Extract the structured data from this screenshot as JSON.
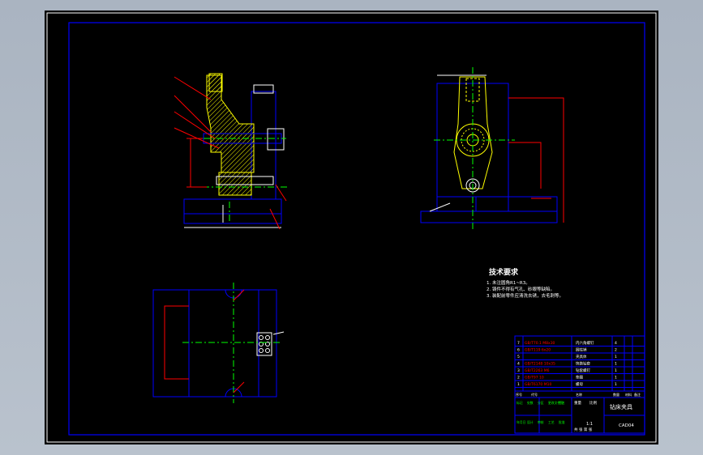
{
  "drawing": {
    "tech_requirements": {
      "heading": "技术要求",
      "lines": [
        "1. 未注圆角R1~R3。",
        "2. 铸件不得有气孔、砂眼等缺陷。",
        "3. 装配前零件应清洗去锈，去毛刺等。"
      ]
    },
    "title_block": {
      "drawing_name": "钻床夹具",
      "drawing_code": "CAD04",
      "scale": "1:1",
      "parts": [
        {
          "code": "GB/T70.1 M8x30",
          "name": "内六角螺钉",
          "qty": "4"
        },
        {
          "code": "GB/T119 6x20",
          "name": "圆柱销",
          "qty": "2"
        },
        {
          "code": "",
          "name": "夹具体",
          "qty": "1"
        },
        {
          "code": "GB/T2148 10x35",
          "name": "快换钻套",
          "qty": "1"
        },
        {
          "code": "GB/T2263 M6",
          "name": "钻套螺钉",
          "qty": "1"
        },
        {
          "code": "GB/T97 10",
          "name": "垫圈",
          "qty": "1"
        },
        {
          "code": "GB/T6170 M10",
          "name": "螺母",
          "qty": "1"
        }
      ],
      "header_cells": [
        "序号",
        "代号",
        "名称",
        "数量",
        "材料",
        "备注"
      ],
      "bottom_cells": [
        "标记",
        "处数",
        "分区",
        "更改文件号",
        "签名",
        "年月日",
        "设计",
        "审核",
        "工艺",
        "批准"
      ],
      "weight_label": "重量",
      "scale_label": "比例",
      "sheet_label": "共 张 第 张"
    }
  },
  "colors": {
    "background": "#000000",
    "frame": "#0000ff",
    "outline": "#ffffff",
    "centerline": "#00ff00",
    "dimension": "#ff0000",
    "hatch": "#ffff00"
  }
}
